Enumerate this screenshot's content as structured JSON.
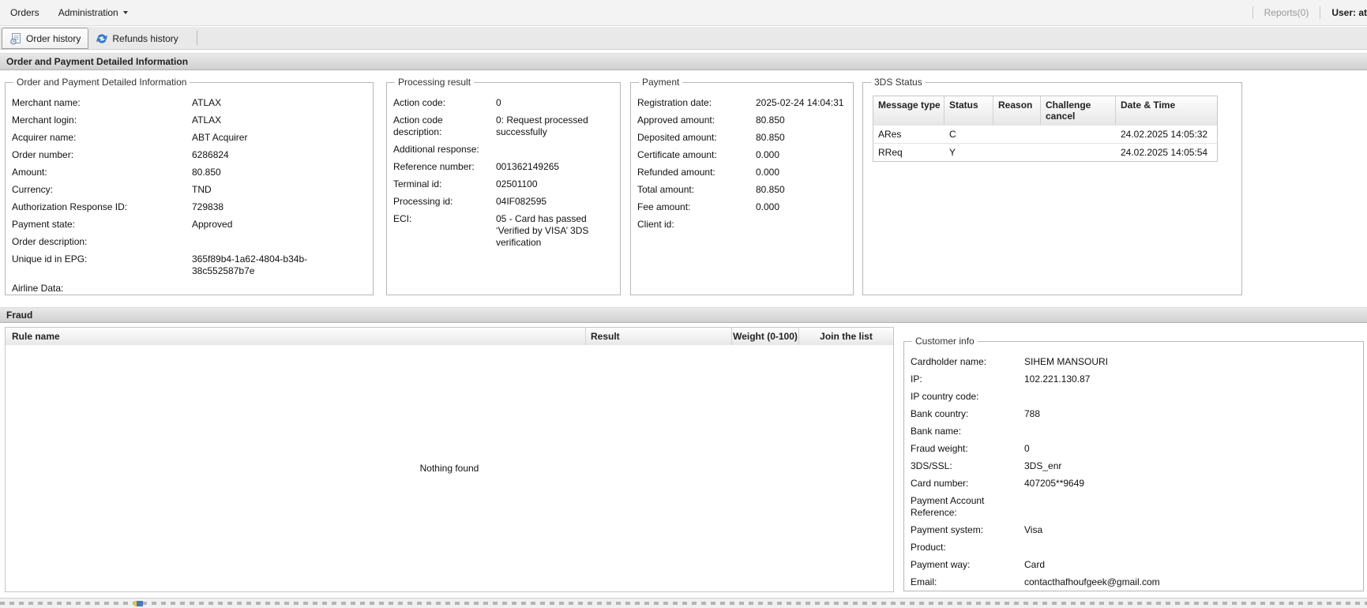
{
  "menubar": {
    "items": [
      {
        "label": "Orders"
      },
      {
        "label": "Administration"
      }
    ],
    "right": {
      "reports": "Reports(0)",
      "user": "User: at"
    }
  },
  "tabs": [
    {
      "label": "Order history",
      "icon": "order-history-icon",
      "active": true
    },
    {
      "label": "Refunds history",
      "icon": "refunds-history-icon",
      "active": false
    }
  ],
  "section_title": "Order and Payment Detailed Information",
  "order_info": {
    "legend": "Order and Payment Detailed Information",
    "fields": [
      {
        "label": "Merchant name:",
        "value": "ATLAX"
      },
      {
        "label": "Merchant login:",
        "value": "ATLAX"
      },
      {
        "label": "Acquirer name:",
        "value": "ABT Acquirer"
      },
      {
        "label": "Order number:",
        "value": "6286824"
      },
      {
        "label": "Amount:",
        "value": "80.850"
      },
      {
        "label": "Currency:",
        "value": "TND"
      },
      {
        "label": "Authorization Response ID:",
        "value": "729838"
      },
      {
        "label": "Payment state:",
        "value": "Approved"
      },
      {
        "label": "Order description:",
        "value": ""
      },
      {
        "label": "Unique id in EPG:",
        "value": "365f89b4-1a62-4804-b34b-38c552587b7e"
      },
      {
        "label": "Airline Data:",
        "value": ""
      }
    ]
  },
  "processing_result": {
    "legend": "Processing result",
    "fields": [
      {
        "label": "Action code:",
        "value": "0"
      },
      {
        "label": "Action code description:",
        "value": "0: Request processed successfully"
      },
      {
        "label": "Additional response:",
        "value": ""
      },
      {
        "label": "Reference number:",
        "value": "001362149265"
      },
      {
        "label": "Terminal id:",
        "value": "02501100"
      },
      {
        "label": "Processing id:",
        "value": "04IF082595"
      },
      {
        "label": "ECI:",
        "value": "05 - Card has passed ‘Verified by VISA’ 3DS verification"
      }
    ]
  },
  "payment": {
    "legend": "Payment",
    "fields": [
      {
        "label": "Registration date:",
        "value": "2025-02-24 14:04:31"
      },
      {
        "label": "Approved amount:",
        "value": "80.850"
      },
      {
        "label": "Deposited amount:",
        "value": "80.850"
      },
      {
        "label": "Certificate amount:",
        "value": "0.000"
      },
      {
        "label": "Refunded amount:",
        "value": "0.000"
      },
      {
        "label": "Total amount:",
        "value": "80.850"
      },
      {
        "label": "Fee amount:",
        "value": "0.000"
      },
      {
        "label": "Client id:",
        "value": ""
      }
    ]
  },
  "tds_status": {
    "legend": "3DS Status",
    "table": {
      "columns": [
        "Message type",
        "Status",
        "Reason",
        "Challenge cancel",
        "Date & Time"
      ],
      "rows": [
        [
          "ARes",
          "C",
          "",
          "",
          "24.02.2025 14:05:32"
        ],
        [
          "RReq",
          "Y",
          "",
          "",
          "24.02.2025 14:05:54"
        ]
      ]
    }
  },
  "fraud": {
    "title": "Fraud",
    "table": {
      "columns": [
        "Rule name",
        "Result",
        "Weight (0-100)",
        "Join the list"
      ],
      "empty_text": "Nothing found"
    }
  },
  "customer_info": {
    "legend": "Customer info",
    "fields": [
      {
        "label": "Cardholder name:",
        "value": "SIHEM MANSOURI"
      },
      {
        "label": "IP:",
        "value": "102.221.130.87"
      },
      {
        "label": "IP country code:",
        "value": ""
      },
      {
        "label": "Bank country:",
        "value": "788"
      },
      {
        "label": "Bank name:",
        "value": ""
      },
      {
        "label": "Fraud weight:",
        "value": "0"
      },
      {
        "label": "3DS/SSL:",
        "value": "3DS_enr"
      },
      {
        "label": "Card number:",
        "value": "407205**9649"
      },
      {
        "label": "Payment Account Reference:",
        "value": ""
      },
      {
        "label": "Payment system:",
        "value": "Visa"
      },
      {
        "label": "Product:",
        "value": ""
      },
      {
        "label": "Payment way:",
        "value": "Card"
      },
      {
        "label": "Email:",
        "value": "contacthafhoufgeek@gmail.com"
      }
    ]
  }
}
